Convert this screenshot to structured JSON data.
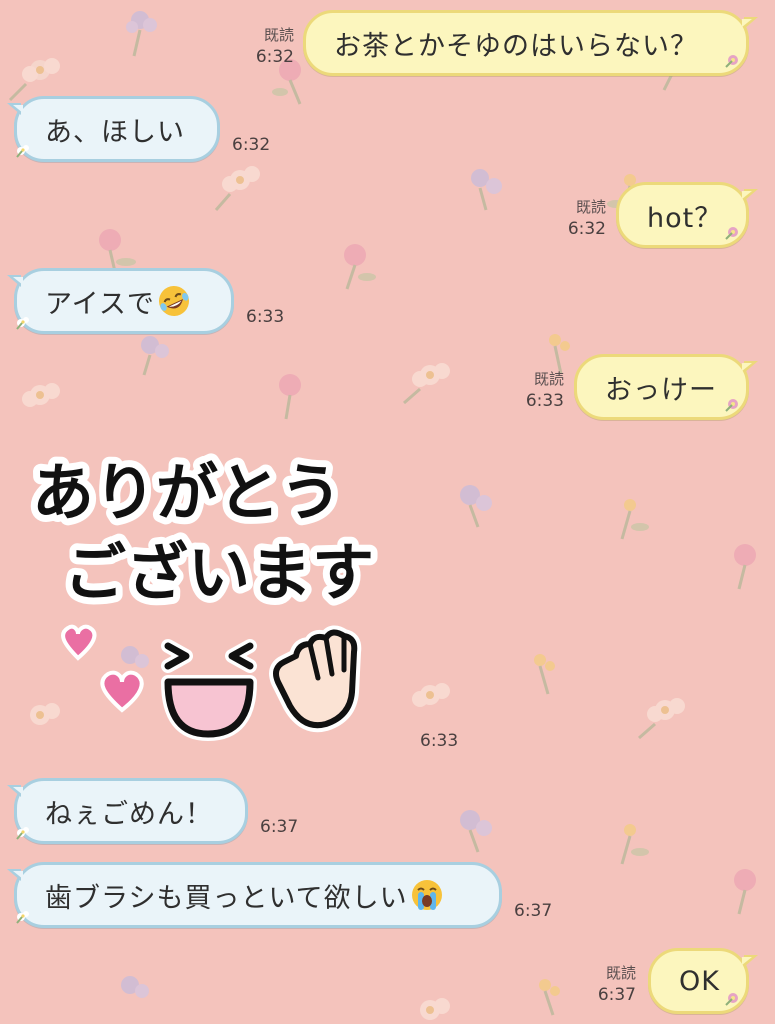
{
  "colors": {
    "background": "#f4c3bc",
    "received_bubble": "#eaf4f9",
    "received_border": "#a8cfe0",
    "sent_bubble": "#fcf6be",
    "sent_border": "#ecd97a",
    "sticker_heart": "#ea6fa3"
  },
  "messages": [
    {
      "side": "sent",
      "text": "お茶とかそゆのはいらない？",
      "read": "既読",
      "time": "6:32"
    },
    {
      "side": "received",
      "text": "あ、ほしい",
      "time": "6:32"
    },
    {
      "side": "sent",
      "text": "hot？",
      "read": "既読",
      "time": "6:32"
    },
    {
      "side": "received",
      "text": "アイスで",
      "emoji": "rolling-on-floor-laughing-emoji",
      "time": "6:33"
    },
    {
      "side": "sent",
      "text": "おっけー",
      "read": "既読",
      "time": "6:33"
    },
    {
      "side": "received",
      "type": "sticker",
      "sticker_text_line1": "ありがとう",
      "sticker_text_line2": "ございます",
      "sticker_icon": "smiling-face-waving-hand-hearts-sticker",
      "time": "6:33"
    },
    {
      "side": "received",
      "text": "ねぇごめん！",
      "time": "6:37"
    },
    {
      "side": "received",
      "text": "歯ブラシも買っといて欲しい",
      "emoji": "loudly-crying-face-emoji",
      "time": "6:37"
    },
    {
      "side": "sent",
      "text": "OK",
      "read": "既読",
      "time": "6:37"
    }
  ]
}
